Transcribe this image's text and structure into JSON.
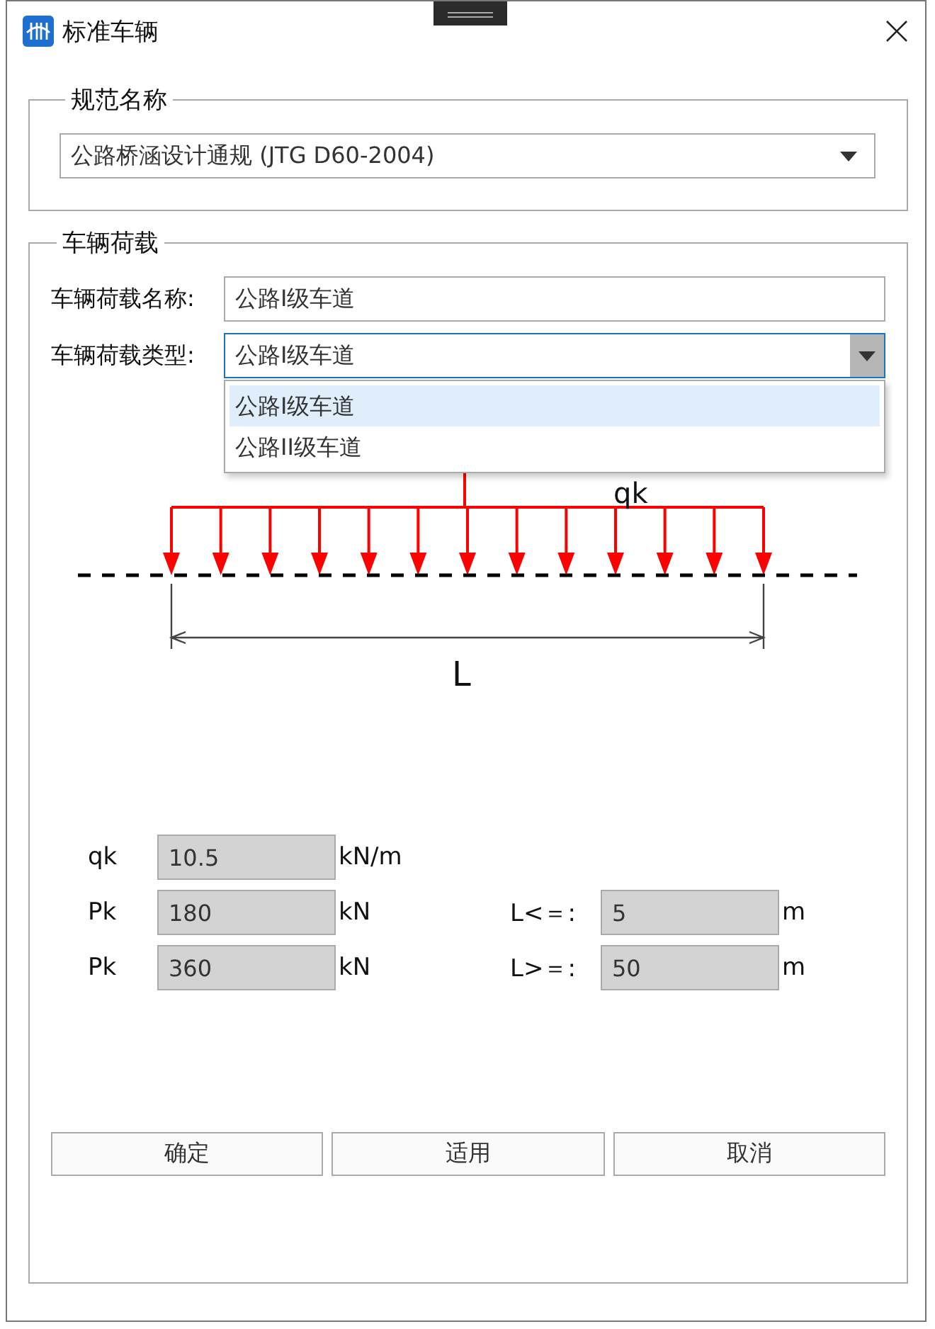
{
  "window": {
    "title": "标准车辆"
  },
  "spec_group": {
    "legend": "规范名称",
    "select": {
      "value": "公路桥涵设计通规 (JTG D60-2004)"
    }
  },
  "load_group": {
    "legend": "车辆荷载",
    "name_field": {
      "label": "车辆荷载名称:",
      "value": "公路I级车道"
    },
    "type_field": {
      "label": "车辆荷载类型:",
      "value": "公路I级车道",
      "expanded": true
    },
    "dropdown": [
      {
        "label": "公路I级车道",
        "selected": true
      },
      {
        "label": "公路II级车道",
        "selected": false
      }
    ],
    "diagram": {
      "load_label": "qk",
      "span_label": "L"
    },
    "params": [
      {
        "cells": [
          {
            "label": "qk",
            "value": "10.5",
            "unit": "kN/m",
            "disabled": true
          }
        ]
      },
      {
        "cells": [
          {
            "label": "Pk",
            "value": "180",
            "unit": "kN",
            "disabled": true
          },
          {
            "label": "L<＝:",
            "value": "5",
            "unit": "m",
            "disabled": true
          }
        ]
      },
      {
        "cells": [
          {
            "label": "Pk",
            "value": "360",
            "unit": "kN",
            "disabled": true
          },
          {
            "label": "L>＝:",
            "value": "50",
            "unit": "m",
            "disabled": true
          }
        ]
      }
    ],
    "buttons": [
      {
        "label": "确定"
      },
      {
        "label": "适用"
      },
      {
        "label": "取消"
      }
    ]
  }
}
